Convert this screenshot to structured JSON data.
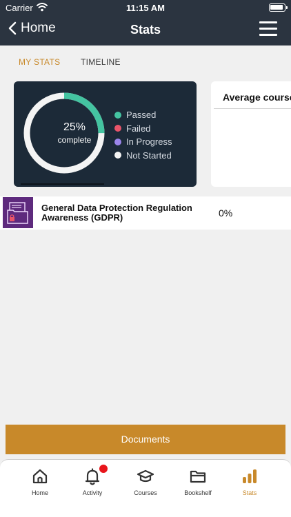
{
  "status_bar": {
    "carrier": "Carrier",
    "time": "11:15 AM"
  },
  "nav": {
    "back_label": "Home",
    "title": "Stats"
  },
  "tabs": [
    {
      "label": "MY STATS",
      "active": true
    },
    {
      "label": "TIMELINE",
      "active": false
    }
  ],
  "progress_card": {
    "percent_label": "25%",
    "subtitle": "complete",
    "passed_fraction": 0.25,
    "legend": [
      {
        "label": "Passed",
        "color": "#44c4a1"
      },
      {
        "label": "Failed",
        "color": "#e8546a"
      },
      {
        "label": "In Progress",
        "color": "#9b85ea"
      },
      {
        "label": "Not Started",
        "color": "#f4f4f4"
      }
    ]
  },
  "average_card": {
    "title": "Average course score"
  },
  "courses": [
    {
      "title": "General Data Protection Regulation Awareness (GDPR)",
      "percent": "0%",
      "icon": "folder-lock-icon"
    }
  ],
  "documents_button": {
    "label": "Documents"
  },
  "bottom_tabs": [
    {
      "label": "Home",
      "icon": "home-icon",
      "active": false
    },
    {
      "label": "Activity",
      "icon": "bell-icon",
      "active": false,
      "badge": true
    },
    {
      "label": "Courses",
      "icon": "graduation-cap-icon",
      "active": false
    },
    {
      "label": "Bookshelf",
      "icon": "folder-icon",
      "active": false
    },
    {
      "label": "Stats",
      "icon": "bar-chart-icon",
      "active": true
    }
  ],
  "colors": {
    "accent": "#c8892a",
    "header": "#2b3440",
    "card_dark": "#1c2a38"
  }
}
